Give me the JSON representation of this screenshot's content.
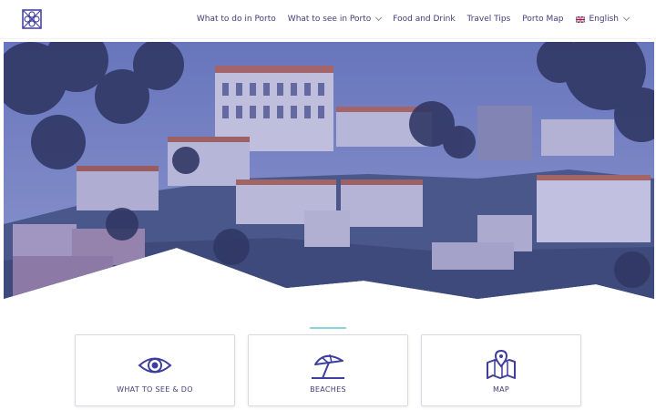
{
  "header": {
    "nav": [
      {
        "label": "What to do in Porto",
        "has_dropdown": false
      },
      {
        "label": "What to see in Porto",
        "has_dropdown": true
      },
      {
        "label": "Food and Drink",
        "has_dropdown": false
      },
      {
        "label": "Travel Tips",
        "has_dropdown": false
      },
      {
        "label": "Porto Map",
        "has_dropdown": false
      }
    ],
    "language": {
      "label": "English",
      "flag": "uk-flag-icon"
    }
  },
  "hero": {
    "image": "porto-city-hillside-photo"
  },
  "colors": {
    "brand": "#3f3d7a",
    "accent": "#8fd5df",
    "hero_tint": "#4a4f9e"
  },
  "cards": [
    {
      "label": "WHAT TO SEE & DO",
      "icon": "eye-icon"
    },
    {
      "label": "BEACHES",
      "icon": "beach-umbrella-icon"
    },
    {
      "label": "MAP",
      "icon": "map-pin-icon"
    }
  ]
}
